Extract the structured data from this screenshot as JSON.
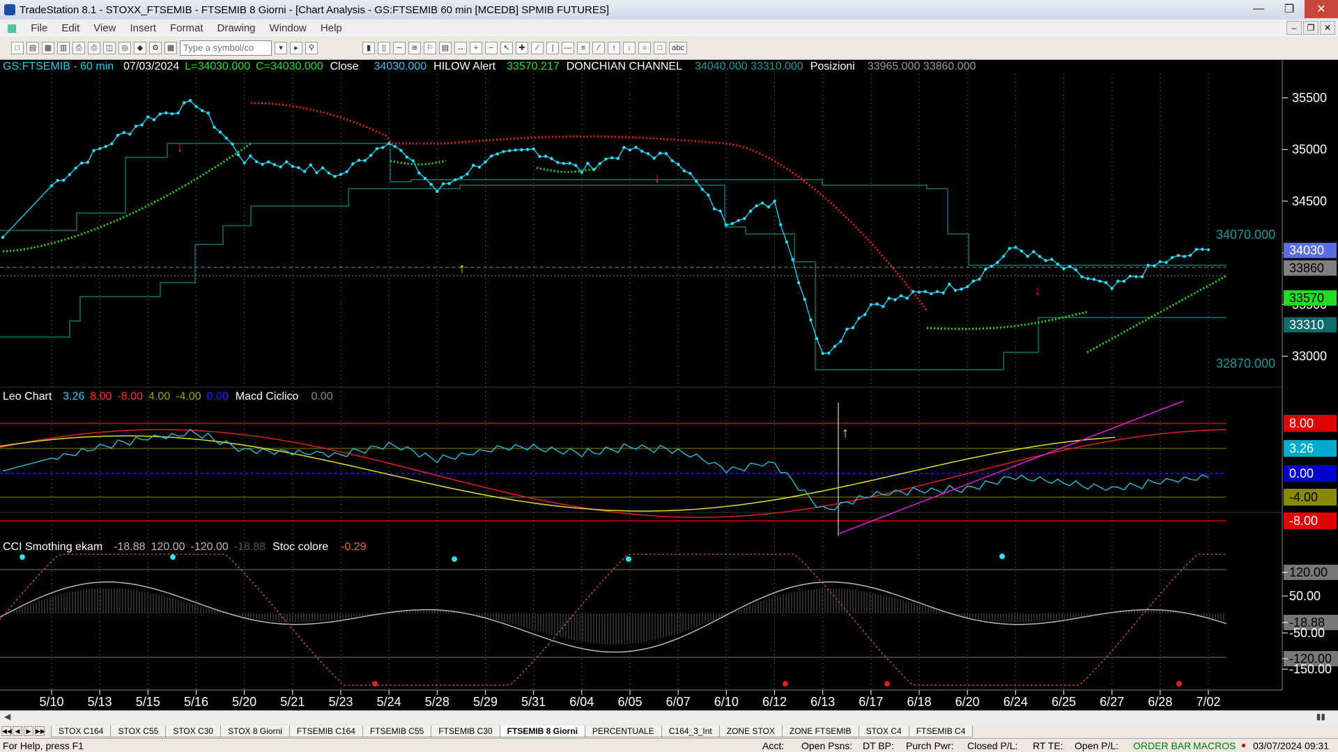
{
  "window": {
    "title": "TradeStation 8.1 - STOXX_FTSEMIB - FTSEMIB  8 Giorni - [Chart Analysis - GS:FTSEMIB  60 min  [MCEDB] SPMIB FUTURES]"
  },
  "menu": [
    "File",
    "Edit",
    "View",
    "Insert",
    "Format",
    "Drawing",
    "Window",
    "Help"
  ],
  "toolbar": {
    "symbol_placeholder": "Type a symbol/co",
    "text_tool": "abc"
  },
  "price_panel": {
    "symbol": "GS:FTSEMIB - 60 min",
    "date": "07/03/2024",
    "low": "L=34030.000",
    "close": "C=34030.000",
    "close_label": "Close",
    "close_value": "34030.000",
    "hilow_label": "HILOW Alert",
    "hilow_value": "33570.217",
    "donchian_label": "DONCHIAN CHANNEL",
    "donchian_values": "34040.000  33310.000",
    "posizioni_label": "Posizioni",
    "posizioni_values": "33965.000  33860.000",
    "axis_ticks": [
      "35500",
      "35000",
      "34500",
      "34000",
      "33500",
      "33000"
    ],
    "channel_top_label": "34070.000",
    "channel_bottom_label": "32870.000",
    "badges": [
      {
        "text": "34030",
        "bg": "#5a6ee0",
        "fg": "#ffffff"
      },
      {
        "text": "33860",
        "bg": "#808080",
        "fg": "#000000"
      },
      {
        "text": "33570",
        "bg": "#22dd22",
        "fg": "#000000"
      },
      {
        "text": "33310",
        "bg": "#0e6c6c",
        "fg": "#ffffff"
      }
    ]
  },
  "leo_panel": {
    "title": "Leo Chart",
    "values": [
      "3.26",
      "8.00",
      "-8.00",
      "4.00",
      "-4.00",
      "0.00"
    ],
    "macd_label": "Macd Ciclico",
    "macd_value": "0.00",
    "badges": [
      {
        "text": "8.00",
        "bg": "#e00000",
        "fg": "#ffffff"
      },
      {
        "text": "3.26",
        "bg": "#00aacc",
        "fg": "#ffffff"
      },
      {
        "text": "0.00",
        "bg": "#0000cc",
        "fg": "#ffffff"
      },
      {
        "text": "-4.00",
        "bg": "#8a8a00",
        "fg": "#000000"
      },
      {
        "text": "-8.00",
        "bg": "#e00000",
        "fg": "#ffffff"
      }
    ]
  },
  "cci_panel": {
    "title": "CCI Smothing ekam",
    "values": [
      "-18.88",
      "120.00",
      "-120.00",
      "-18.88"
    ],
    "stoc_label": "Stoc colore",
    "stoc_value": "-0.29",
    "axis_ticks": [
      "120.00",
      "50.00",
      "-18.88",
      "-50.00",
      "-120.00",
      "-150.00"
    ]
  },
  "dates": [
    "5/10",
    "5/13",
    "5/15",
    "5/16",
    "5/20",
    "5/21",
    "5/23",
    "5/24",
    "5/28",
    "5/29",
    "5/31",
    "6/04",
    "6/05",
    "6/07",
    "6/10",
    "6/12",
    "6/13",
    "6/17",
    "6/18",
    "6/20",
    "6/24",
    "6/25",
    "6/27",
    "6/28",
    "7/02"
  ],
  "tabs": [
    "STOX C164",
    "STOX C55",
    "STOX  C30",
    "STOX  8 Giorni",
    "FTSEMIB C164",
    "FTSEMIB C55",
    "FTSEMIB C30",
    "FTSEMIB  8 Giorni",
    "PERCENTUALE",
    "C164_3_Int",
    "ZONE STOX",
    "ZONE FTSEMIB",
    "STOX  C4",
    "FTSEMIB C4"
  ],
  "active_tab": "FTSEMIB  8 Giorni",
  "status": {
    "help": "For Help, press F1",
    "acct": "Acct:",
    "open_psns": "Open Psns:",
    "dt_bp": "DT BP:",
    "purch_pwr": "Purch Pwr:",
    "closed_pl": "Closed P/L:",
    "rt_te": "RT TE:",
    "open_pl": "Open P/L:",
    "order_bar": "ORDER BAR",
    "macros": "MACROS",
    "datetime": "03/07/2024 09:31"
  },
  "chart_data": {
    "type": "line",
    "x": [
      "5/10",
      "5/13",
      "5/15",
      "5/16",
      "5/20",
      "5/21",
      "5/23",
      "5/24",
      "5/28",
      "5/29",
      "5/31",
      "6/04",
      "6/05",
      "6/07",
      "6/10",
      "6/12",
      "6/13",
      "6/17",
      "6/18",
      "6/20",
      "6/24",
      "6/25",
      "6/27",
      "6/28",
      "7/02"
    ],
    "price": [
      34650,
      35000,
      35300,
      35450,
      34900,
      34850,
      34750,
      35100,
      34600,
      34900,
      35000,
      34800,
      35000,
      34900,
      34300,
      34500,
      33000,
      33500,
      33600,
      33700,
      34050,
      33850,
      33650,
      33900,
      34030
    ],
    "ylim": [
      32700,
      35800
    ],
    "donchian_upper": 34070,
    "donchian_lower": 32870
  }
}
